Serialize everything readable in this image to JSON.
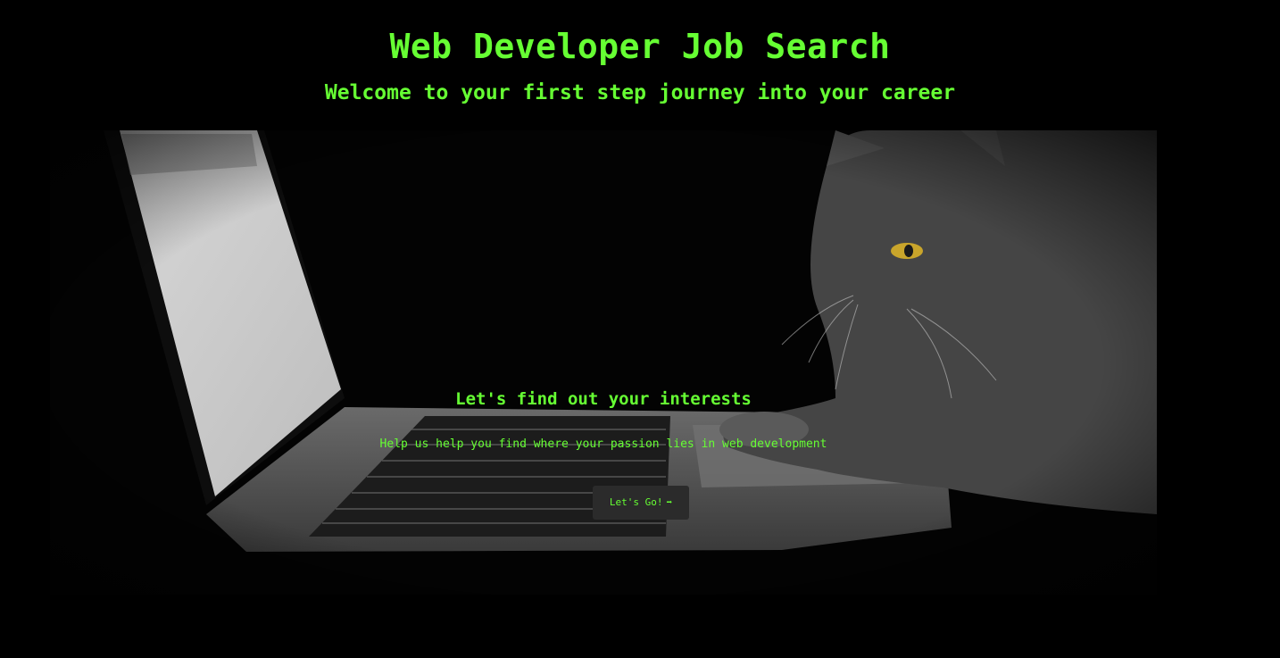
{
  "header": {
    "title": "Web Developer Job Search",
    "subtitle": "Welcome to your first step journey into your career"
  },
  "hero": {
    "image_alt": "Cat using a laptop",
    "heading": "Let's find out your interests",
    "text": "Help us help you find where your passion lies in web development",
    "button_label": "Let's Go!",
    "button_icon": "arrow-right-icon",
    "button_arrow": "➡"
  },
  "colors": {
    "background": "#000000",
    "accent": "#66ff33",
    "button_background": "#2b2b2b"
  }
}
